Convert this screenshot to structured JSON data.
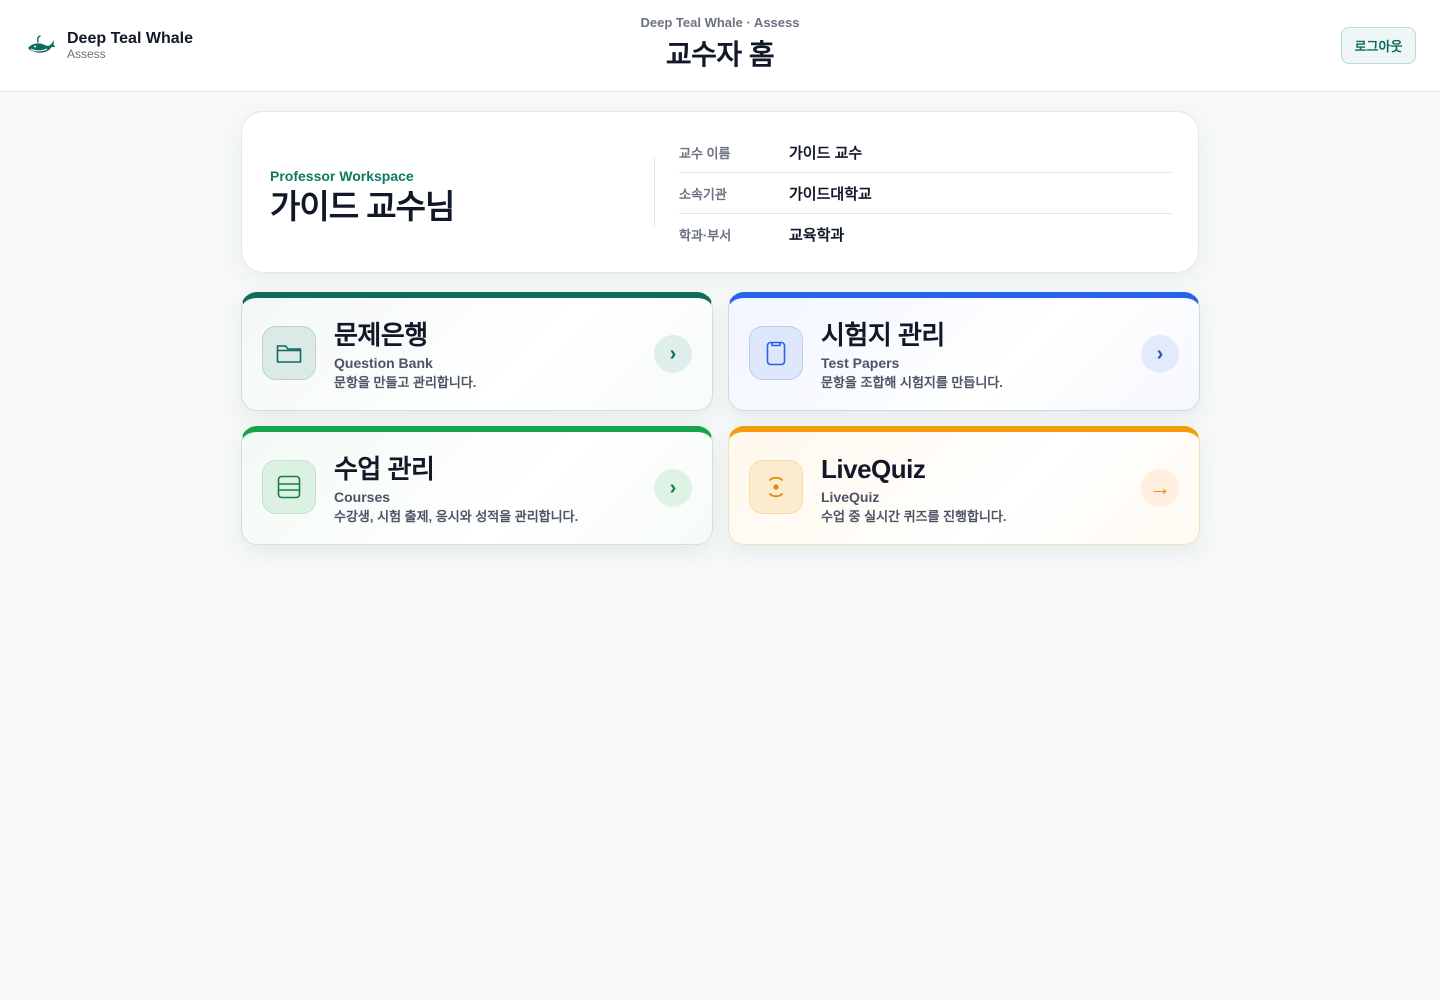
{
  "header": {
    "brand_name": "Deep Teal Whale",
    "brand_sub": "Assess",
    "crumb": "Deep Teal Whale · Assess",
    "title": "교수자 홈",
    "logout_label": "로그아웃"
  },
  "profile": {
    "workspace_label": "Professor Workspace",
    "name": "가이드 교수님",
    "rows": [
      {
        "label": "교수 이름",
        "value": "가이드 교수"
      },
      {
        "label": "소속기관",
        "value": "가이드대학교"
      },
      {
        "label": "학과·부서",
        "value": "교육학과"
      }
    ]
  },
  "tiles": {
    "question_bank": {
      "title": "문제은행",
      "subtitle": "Question Bank",
      "desc": "문항을 만들고 관리합니다.",
      "arrow": "›",
      "icon": "folder-icon",
      "accent": "#0f6b5b"
    },
    "test_papers": {
      "title": "시험지 관리",
      "subtitle": "Test Papers",
      "desc": "문항을 조합해 시험지를 만듭니다.",
      "arrow": "›",
      "icon": "clipboard-icon",
      "accent": "#2563eb"
    },
    "courses": {
      "title": "수업 관리",
      "subtitle": "Courses",
      "desc": "수강생, 시험 출제, 응시와 성적을 관리합니다.",
      "arrow": "›",
      "icon": "list-icon",
      "accent": "#16a34a"
    },
    "livequiz": {
      "title": "LiveQuiz",
      "subtitle": "LiveQuiz",
      "desc": "수업 중 실시간 퀴즈를 진행합니다.",
      "arrow": "→",
      "icon": "broadcast-icon",
      "accent": "#f59e0b"
    }
  }
}
